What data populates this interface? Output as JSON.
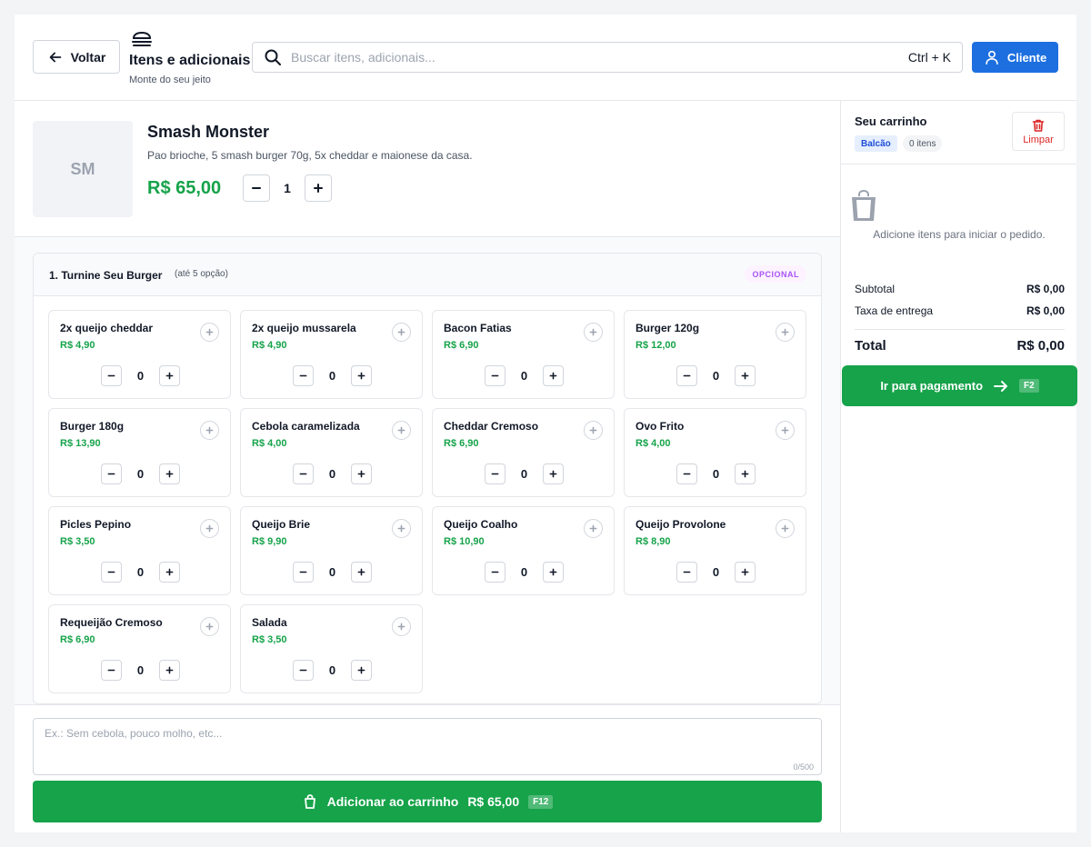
{
  "header": {
    "back_label": "Voltar",
    "title": "Itens e adicionais",
    "subtitle": "Monte do seu jeito",
    "search_placeholder": "Buscar itens, adicionais...",
    "search_shortcut": "Ctrl + K",
    "client_label": "Cliente"
  },
  "product": {
    "thumb_initials": "SM",
    "name": "Smash Monster",
    "description": "Pao brioche, 5 smash burger 70g, 5x cheddar e maionese da casa.",
    "price": "R$ 65,00",
    "quantity": "1"
  },
  "group": {
    "title": "1. Turnine Seu Burger",
    "limit": "(até 5 opção)",
    "badge": "OPCIONAL",
    "items": [
      {
        "name": "2x queijo cheddar",
        "price": "R$ 4,90",
        "qty": "0"
      },
      {
        "name": "2x queijo mussarela",
        "price": "R$ 4,90",
        "qty": "0"
      },
      {
        "name": "Bacon Fatias",
        "price": "R$ 6,90",
        "qty": "0"
      },
      {
        "name": "Burger 120g",
        "price": "R$ 12,00",
        "qty": "0"
      },
      {
        "name": "Burger 180g",
        "price": "R$ 13,90",
        "qty": "0"
      },
      {
        "name": "Cebola caramelizada",
        "price": "R$ 4,00",
        "qty": "0"
      },
      {
        "name": "Cheddar Cremoso",
        "price": "R$ 6,90",
        "qty": "0"
      },
      {
        "name": "Ovo Frito",
        "price": "R$ 4,00",
        "qty": "0"
      },
      {
        "name": "Picles Pepino",
        "price": "R$ 3,50",
        "qty": "0"
      },
      {
        "name": "Queijo Brie",
        "price": "R$ 9,90",
        "qty": "0"
      },
      {
        "name": "Queijo Coalho",
        "price": "R$ 10,90",
        "qty": "0"
      },
      {
        "name": "Queijo Provolone",
        "price": "R$ 8,90",
        "qty": "0"
      },
      {
        "name": "Requeijão Cremoso",
        "price": "R$ 6,90",
        "qty": "0"
      },
      {
        "name": "Salada",
        "price": "R$ 3,50",
        "qty": "0"
      }
    ]
  },
  "notes": {
    "placeholder": "Ex.: Sem cebola, pouco molho, etc...",
    "counter": "0/500"
  },
  "add_to_cart": {
    "label": "Adicionar ao carrinho",
    "price": "R$ 65,00",
    "shortcut": "F12"
  },
  "cart": {
    "title": "Seu carrinho",
    "mode_badge": "Balcão",
    "items_badge": "0 itens",
    "clear_label": "Limpar",
    "empty_text": "Adicione itens para iniciar o pedido.",
    "subtotal_label": "Subtotal",
    "subtotal_value": "R$ 0,00",
    "delivery_label": "Taxa de entrega",
    "delivery_value": "R$ 0,00",
    "total_label": "Total",
    "total_value": "R$ 0,00",
    "pay_label": "Ir para pagamento",
    "pay_shortcut": "F2"
  },
  "colors": {
    "accent_blue": "#1d6fe0",
    "green": "#16a34a",
    "danger": "#dc2626",
    "optional_badge": "#a855f7"
  }
}
